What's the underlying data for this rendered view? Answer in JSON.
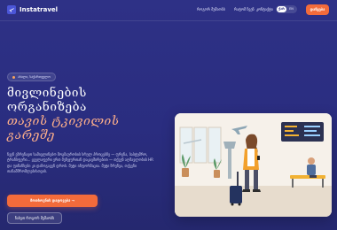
{
  "brand": {
    "name": "Instatravel",
    "logo_icon": "airplane-icon"
  },
  "nav": {
    "links": [
      "როგორ მუშაობს",
      "რატომ ჩვენ",
      "კონტაქტი"
    ],
    "lang": [
      "ქარ",
      "EN"
    ],
    "cta": "დაწყება"
  },
  "hero": {
    "badge": "ახალი, საქართველო",
    "title_line1": "მივლინების",
    "title_line2": "ორგანიზება",
    "title_line3": "თავის ტკივილის",
    "title_line4": "გარეშე",
    "lead": "ჩვენ ვზრუნავთ სამივლინებო მოგზაურობის სრულ პროცესზე — ფრენა, სასტუმრო, ტრანსფერი... ყველაფერი ერთ მენეჯერთან დაკავშირებით — თქვენ აღმავლობის HR და ფინანსები კი დაზოგავენ დროს. მეტი ინფორმაცია. მეტი ზრუნვა, თქვენი თანამშრომლებისთვის.",
    "primary_button": "მოთხოვნის დატოვება →",
    "secondary_button": "ნახეთ როგორ მუშაობს"
  },
  "colors": {
    "background": "#2e3186",
    "accent": "#f36b3b",
    "accent_text": "#ffb08a"
  },
  "illustration": "traveler-with-suitcase-in-airport"
}
